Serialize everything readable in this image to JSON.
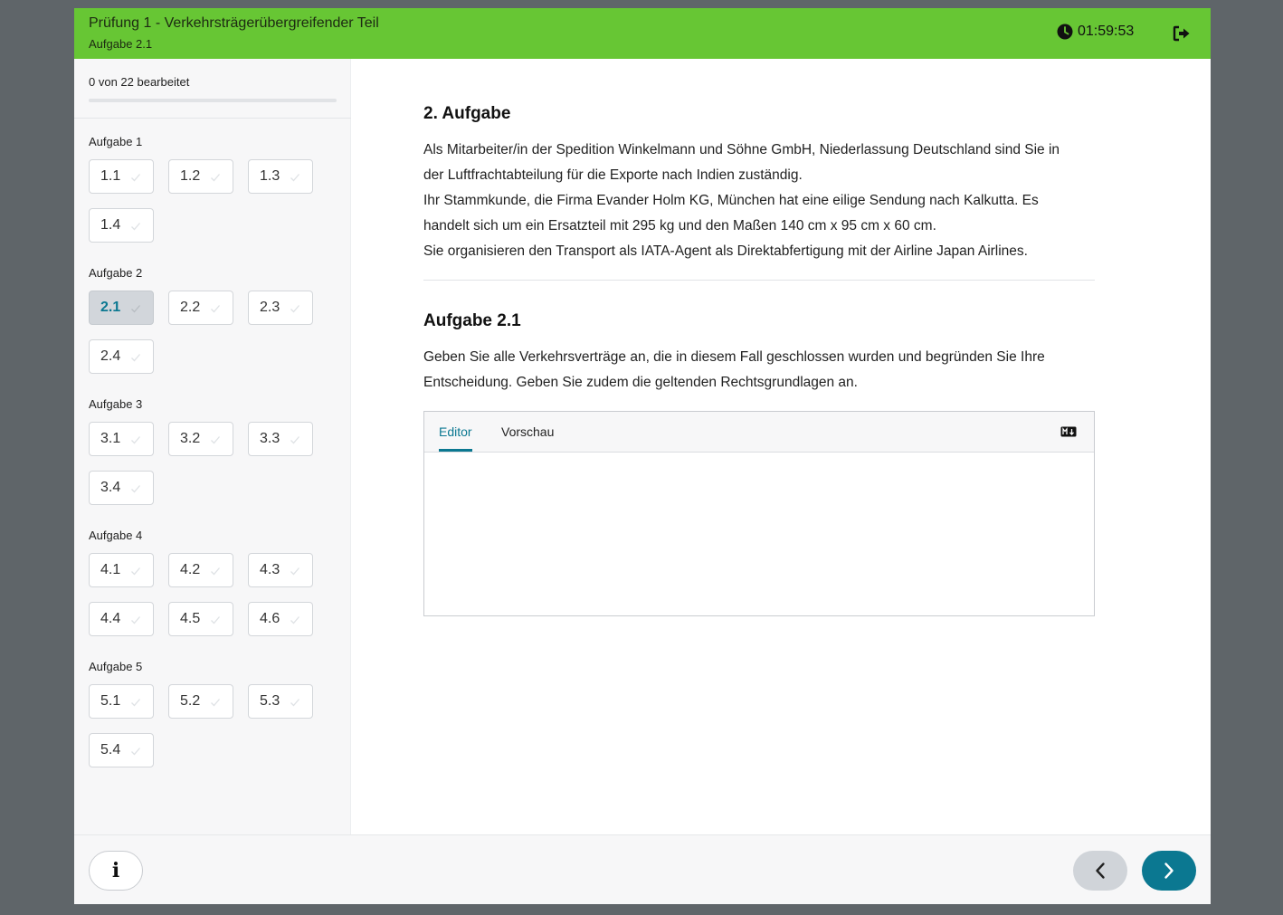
{
  "header": {
    "title": "Prüfung 1 - Verkehrsträgerübergreifender Teil",
    "subtitle": "Aufgabe 2.1",
    "timer": "01:59:53",
    "timer_icon": "clock-icon",
    "exit_icon": "sign-out-icon",
    "background_color": "#67c634"
  },
  "sidebar": {
    "progress_text": "0 von 22 bearbeitet",
    "progress_fraction": 0,
    "groups": [
      {
        "label": "Aufgabe 1",
        "tasks": [
          "1.1",
          "1.2",
          "1.3",
          "1.4"
        ]
      },
      {
        "label": "Aufgabe 2",
        "tasks": [
          "2.1",
          "2.2",
          "2.3",
          "2.4"
        ]
      },
      {
        "label": "Aufgabe 3",
        "tasks": [
          "3.1",
          "3.2",
          "3.3",
          "3.4"
        ]
      },
      {
        "label": "Aufgabe 4",
        "tasks": [
          "4.1",
          "4.2",
          "4.3",
          "4.4",
          "4.5",
          "4.6"
        ]
      },
      {
        "label": "Aufgabe 5",
        "tasks": [
          "5.1",
          "5.2",
          "5.3",
          "5.4"
        ]
      }
    ],
    "active_task": "2.1"
  },
  "main": {
    "section_title": "2. Aufgabe",
    "intro_lines": [
      "Als Mitarbeiter/in der Spedition Winkelmann und Söhne GmbH, Niederlassung Deutschland sind Sie in",
      "der Luftfrachtabteilung für die Exporte nach Indien zuständig.",
      "Ihr Stammkunde, die Firma Evander Holm KG, München hat eine eilige Sendung nach Kalkutta. Es",
      "handelt sich um ein Ersatzteil mit 295 kg und den Maßen 140 cm x 95 cm x 60 cm.",
      "Sie organisieren den Transport als IATA-Agent als Direktabfertigung mit der Airline Japan Airlines."
    ],
    "task_title": "Aufgabe 2.1",
    "task_lines": [
      "Geben Sie alle Verkehrsverträge an, die in diesem Fall geschlossen wurden und begründen Sie Ihre",
      "Entscheidung. Geben Sie zudem die geltenden Rechtsgrundlagen an."
    ],
    "editor": {
      "tab_editor": "Editor",
      "tab_preview": "Vorschau",
      "markdown_icon": "markdown-icon",
      "content": ""
    }
  },
  "footer": {
    "info_label": "i",
    "prev_icon": "chevron-left-icon",
    "next_icon": "chevron-right-icon",
    "accent_color": "#0b7891"
  }
}
